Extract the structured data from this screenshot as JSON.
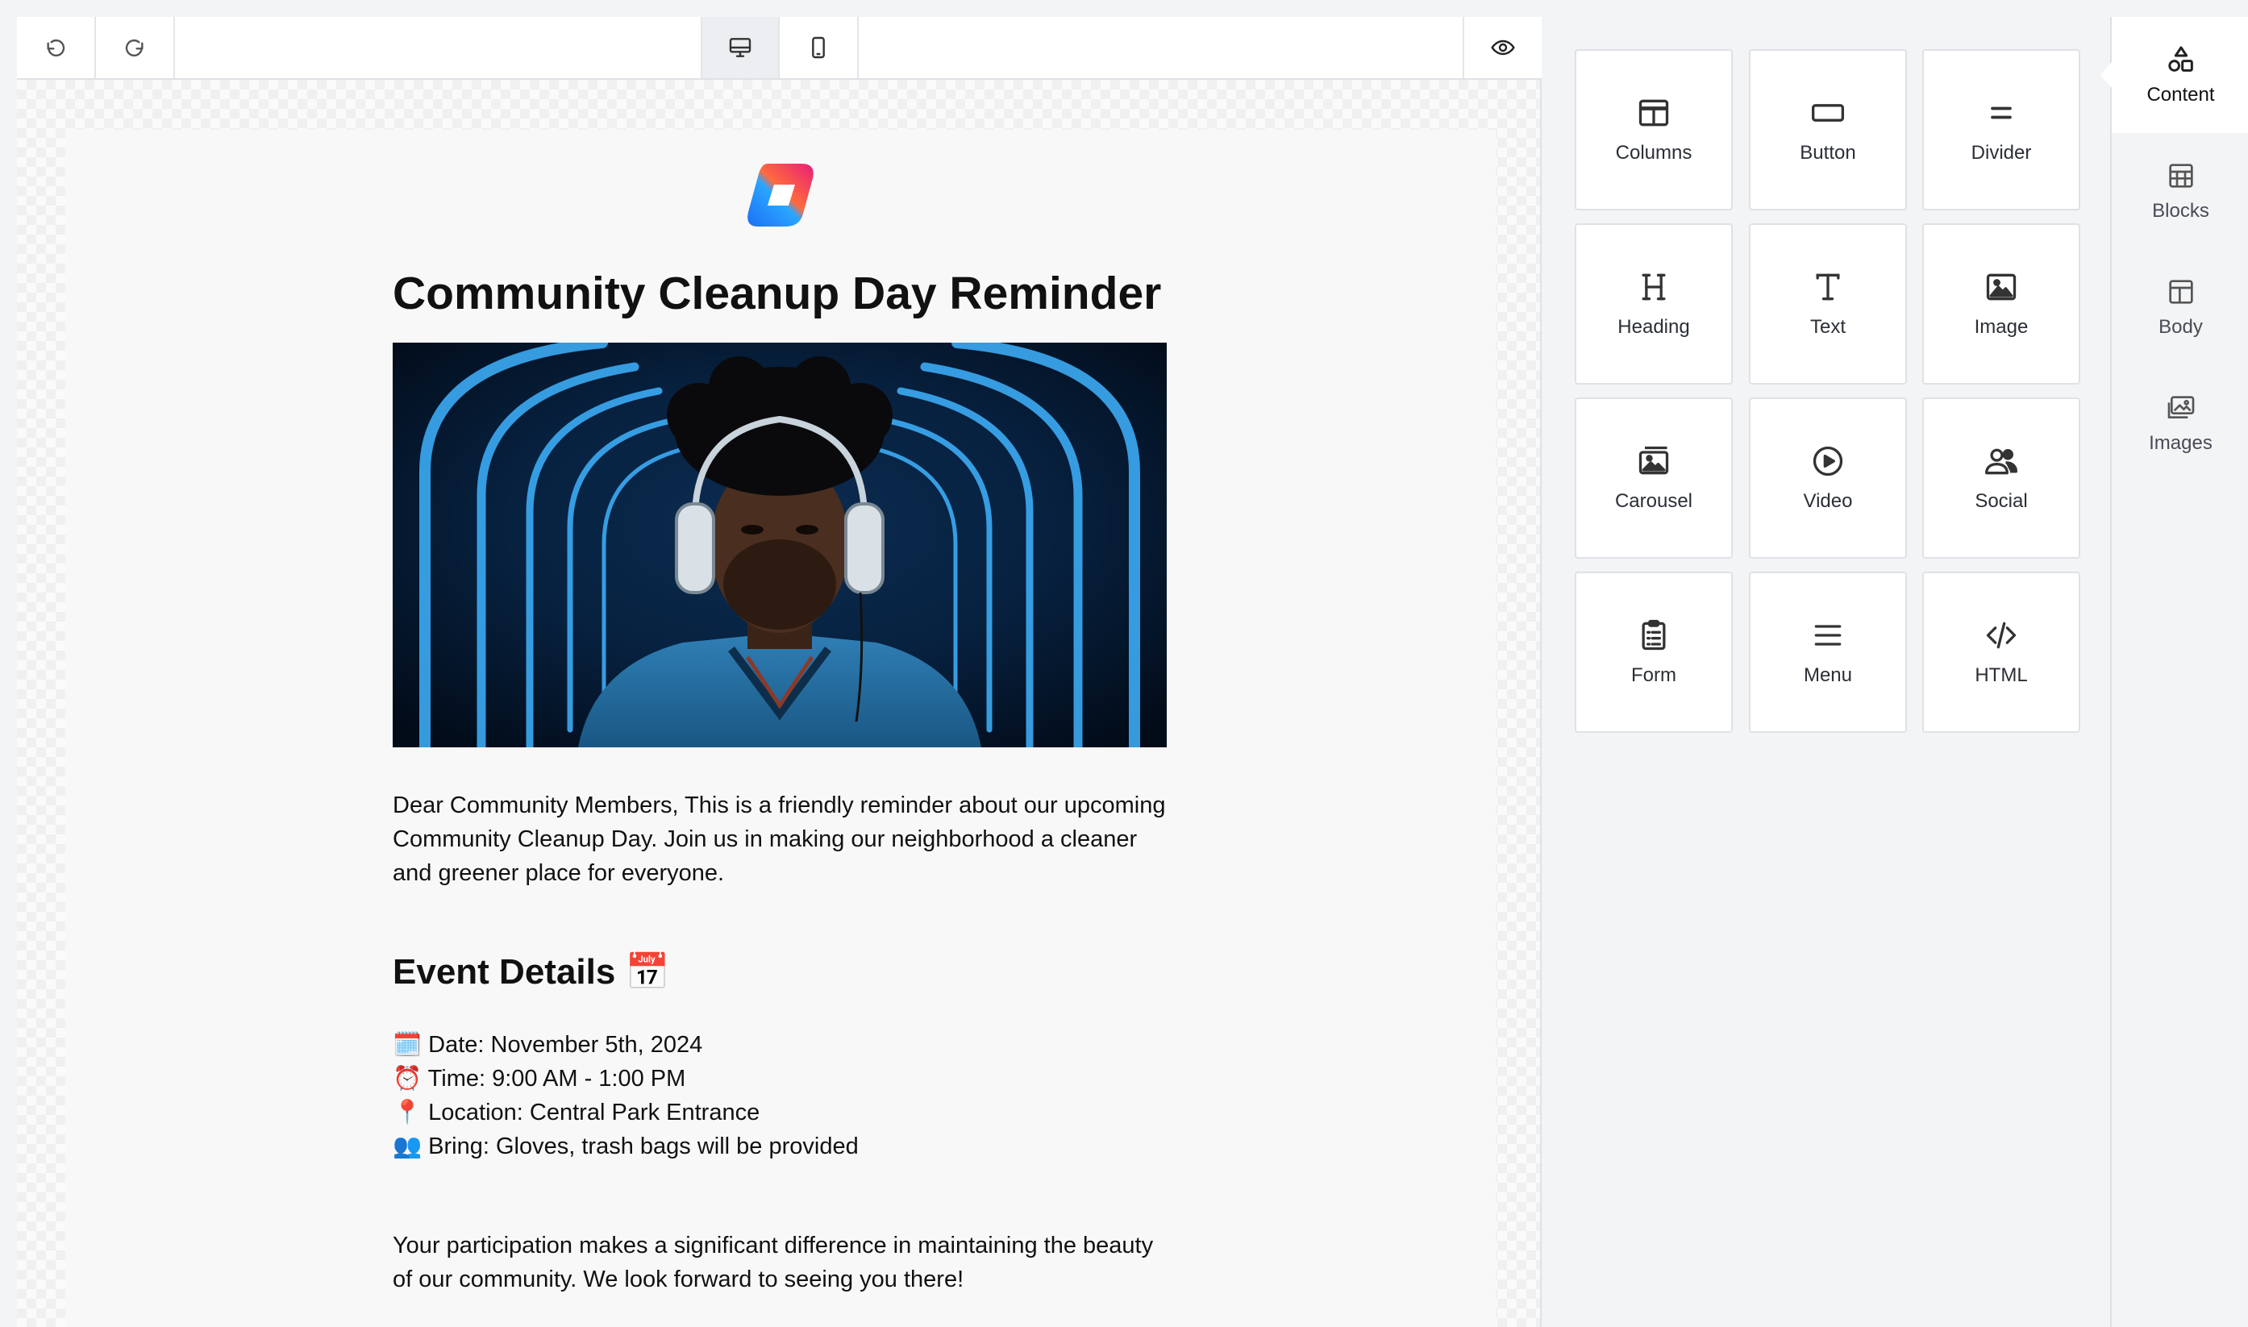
{
  "toolbar": {
    "undo": "undo-icon",
    "redo": "redo-icon",
    "desktop": "desktop-icon",
    "mobile": "mobile-icon",
    "preview": "eye-icon"
  },
  "email": {
    "title": "Community Cleanup Day Reminder",
    "intro": "Dear Community Members, This is a friendly reminder about our upcoming Community Cleanup Day. Join us in making our neighborhood a cleaner and greener place for everyone.",
    "details_heading": "Event Details 📅",
    "details": [
      "🗓️ Date: November 5th, 2024",
      "⏰ Time: 9:00 AM - 1:00 PM",
      "📍 Location: Central Park Entrance",
      "👥 Bring: Gloves, trash bags will be provided"
    ],
    "closing": "Your participation makes a significant difference in maintaining the beauty of our community. We look forward to seeing you there!"
  },
  "tools": [
    {
      "label": "Columns",
      "icon": "columns-icon"
    },
    {
      "label": "Button",
      "icon": "button-icon"
    },
    {
      "label": "Divider",
      "icon": "divider-icon"
    },
    {
      "label": "Heading",
      "icon": "heading-icon"
    },
    {
      "label": "Text",
      "icon": "text-icon"
    },
    {
      "label": "Image",
      "icon": "image-icon"
    },
    {
      "label": "Carousel",
      "icon": "carousel-icon"
    },
    {
      "label": "Video",
      "icon": "video-icon"
    },
    {
      "label": "Social",
      "icon": "social-icon"
    },
    {
      "label": "Form",
      "icon": "form-icon"
    },
    {
      "label": "Menu",
      "icon": "menu-icon"
    },
    {
      "label": "HTML",
      "icon": "code-icon"
    }
  ],
  "sidetabs": [
    {
      "label": "Content",
      "icon": "shapes-icon",
      "active": true
    },
    {
      "label": "Blocks",
      "icon": "blocks-icon",
      "active": false
    },
    {
      "label": "Body",
      "icon": "body-icon",
      "active": false
    },
    {
      "label": "Images",
      "icon": "images-icon",
      "active": false
    }
  ],
  "colors": {
    "accent": "#1a73e8",
    "border": "#dfe1e5",
    "text": "#111111"
  }
}
